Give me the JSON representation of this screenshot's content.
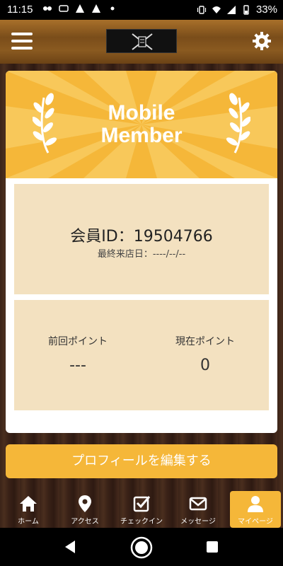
{
  "status_bar": {
    "time": "11:15",
    "battery": "33%"
  },
  "header": {
    "menu_icon": "hamburger-icon",
    "settings_icon": "gear-icon"
  },
  "card": {
    "title_line1": "Mobile",
    "title_line2": "Member",
    "member_id": "会員ID：19504766",
    "last_visit": "最終来店日：----/--/--",
    "previous_points_label": "前回ポイント",
    "previous_points_value": "---",
    "current_points_label": "現在ポイント",
    "current_points_value": "0"
  },
  "edit_profile_button": "プロフィールを編集する",
  "tabs": [
    {
      "label": "ホーム",
      "icon": "home-icon"
    },
    {
      "label": "アクセス",
      "icon": "map-pin-icon"
    },
    {
      "label": "チェックイン",
      "icon": "checkbox-icon"
    },
    {
      "label": "メッセージ",
      "icon": "mail-icon"
    },
    {
      "label": "マイページ",
      "icon": "user-icon"
    }
  ],
  "colors": {
    "accent": "#f5b739",
    "panel": "#f3e1c0"
  }
}
